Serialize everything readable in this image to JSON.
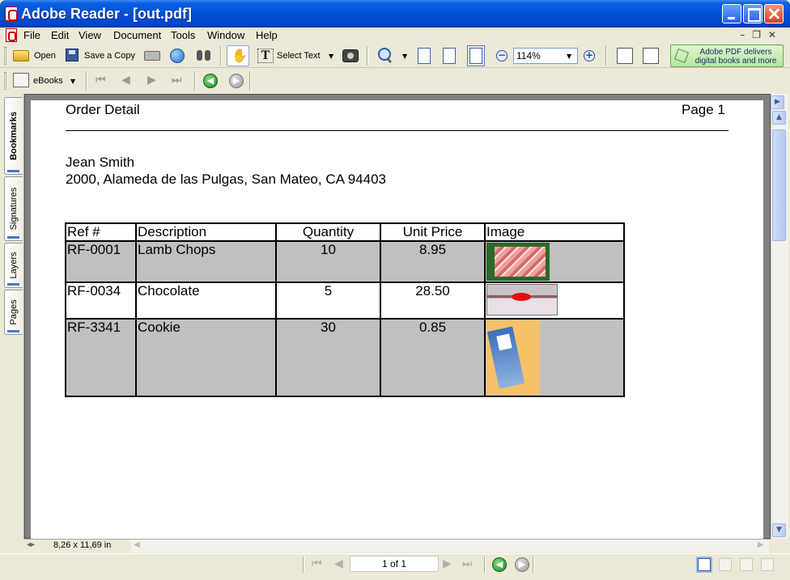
{
  "window": {
    "title": "Adobe Reader - [out.pdf]"
  },
  "menu": {
    "items": [
      "File",
      "Edit",
      "View",
      "Document",
      "Tools",
      "Window",
      "Help"
    ]
  },
  "toolbar": {
    "open_label": "Open",
    "save_copy_label": "Save a Copy",
    "select_text_label": "Select Text",
    "zoom_value": "114%",
    "promo_line1": "Adobe PDF delivers",
    "promo_line2": "digital books and more",
    "ebooks_label": "eBooks"
  },
  "nav_tabs": [
    "Bookmarks",
    "Signatures",
    "Layers",
    "Pages"
  ],
  "document": {
    "header_title": "Order Detail",
    "header_page": "Page 1",
    "customer_name": "Jean Smith",
    "customer_address": "2000, Alameda de las Pulgas, San Mateo, CA 94403",
    "table": {
      "headers": [
        "Ref #",
        "Description",
        "Quantity",
        "Unit Price",
        "Image"
      ],
      "rows": [
        {
          "ref": "RF-0001",
          "description": "Lamb Chops",
          "quantity": "10",
          "unit_price": "8.95",
          "image": "lamb-chops-photo"
        },
        {
          "ref": "RF-0034",
          "description": "Chocolate",
          "quantity": "5",
          "unit_price": "28.50",
          "image": "chocolate-photo"
        },
        {
          "ref": "RF-3341",
          "description": "Cookie",
          "quantity": "30",
          "unit_price": "0.85",
          "image": "cookie-bar-photo"
        }
      ]
    }
  },
  "statusbar": {
    "page_size": "8,26 x 11,69 in",
    "page_indicator": "1 of 1"
  },
  "colors": {
    "titlebar": "#0050d8",
    "chrome": "#ece9d8",
    "row_shade": "#c0c0c0",
    "promo_bg": "#c8ecb4"
  }
}
